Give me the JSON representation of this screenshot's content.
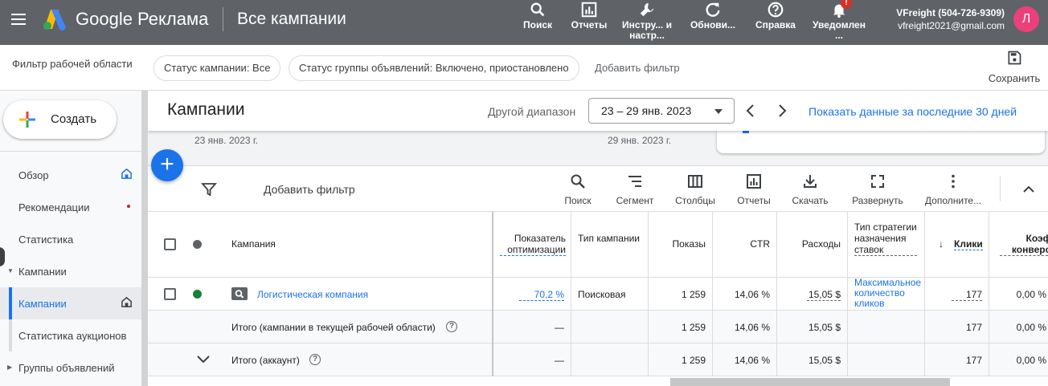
{
  "topbar": {
    "brand": "Google Реклама",
    "page_title": "Все кампании",
    "tools": [
      {
        "label": "Поиск",
        "icon": "search-icon"
      },
      {
        "label": "Отчеты",
        "icon": "reports-icon"
      },
      {
        "label": "Инстру... и настр...",
        "icon": "wrench-icon"
      },
      {
        "label": "Обнови...",
        "icon": "refresh-icon"
      },
      {
        "label": "Справка",
        "icon": "help-icon"
      },
      {
        "label": "Уведомлен ...",
        "icon": "bell-icon",
        "badge": "!"
      }
    ],
    "account_name": "VFreight (504-726-9309)",
    "account_email": "vfreight2021@gmail.com",
    "avatar_letter": "Л"
  },
  "filterbar": {
    "label": "Фильтр рабочей области",
    "chips": [
      "Статус кампании: Все",
      "Статус группы объявлений: Включено, приостановлено"
    ],
    "add_filter": "Добавить фильтр",
    "save": "Сохранить"
  },
  "sidebar": {
    "create": "Создать",
    "items": [
      {
        "label": "Обзор"
      },
      {
        "label": "Рекомендации"
      },
      {
        "label": "Статистика"
      },
      {
        "label": "Кампании"
      },
      {
        "label": "Кампании"
      },
      {
        "label": "Статистика аукционов"
      },
      {
        "label": "Группы объявлений"
      }
    ]
  },
  "header": {
    "title": "Кампании",
    "range_label": "Другой диапазон",
    "range_value": "23 – 29 янв. 2023",
    "show_last": "Показать данные за последние 30 дней"
  },
  "graph": {
    "date_start": "23 янв. 2023 г.",
    "date_end": "29 янв. 2023 г."
  },
  "toolbar": {
    "add_filter": "Добавить фильтр",
    "tools": [
      {
        "label": "Поиск",
        "icon": "search-icon"
      },
      {
        "label": "Сегмент",
        "icon": "segment-icon"
      },
      {
        "label": "Столбцы",
        "icon": "columns-icon"
      },
      {
        "label": "Отчеты",
        "icon": "reports-icon"
      },
      {
        "label": "Скачать",
        "icon": "download-icon"
      },
      {
        "label": "Развернуть",
        "icon": "expand-icon"
      },
      {
        "label": "Дополните...",
        "icon": "more-icon"
      }
    ]
  },
  "table": {
    "headers": {
      "campaign": "Кампания",
      "opt_score": "Показатель оптимизации",
      "campaign_type": "Тип кампании",
      "impressions": "Показы",
      "ctr": "CTR",
      "cost": "Расходы",
      "bid_strategy": "Тип стратегии назначения ставок",
      "clicks": "Клики",
      "conv_rate": "Коэфф. конверсии"
    },
    "rows": [
      {
        "campaign": "Логистическая компания",
        "status_color": "#188038",
        "opt_score": "70,2 %",
        "campaign_type": "Поисковая",
        "impressions": "1 259",
        "ctr": "14,06 %",
        "cost": "15,05 $",
        "bid_strategy": "Максимальное количество кликов",
        "clicks": "177",
        "conv_rate": "0,00 %"
      }
    ],
    "totals": [
      {
        "label": "Итого (кампании в текущей рабочей области)",
        "opt_score": "—",
        "impressions": "1 259",
        "ctr": "14,06 %",
        "cost": "15,05 $",
        "clicks": "177",
        "conv_rate": "0,00 %"
      },
      {
        "label": "Итого (аккаунт)",
        "opt_score": "—",
        "impressions": "1 259",
        "ctr": "14,06 %",
        "cost": "15,05 $",
        "clicks": "177",
        "conv_rate": "0,00 %"
      }
    ]
  },
  "colors": {
    "topbar": "#5f6368",
    "accent": "#1a73e8",
    "active_status": "#188038",
    "avatar": "#ec407a"
  }
}
